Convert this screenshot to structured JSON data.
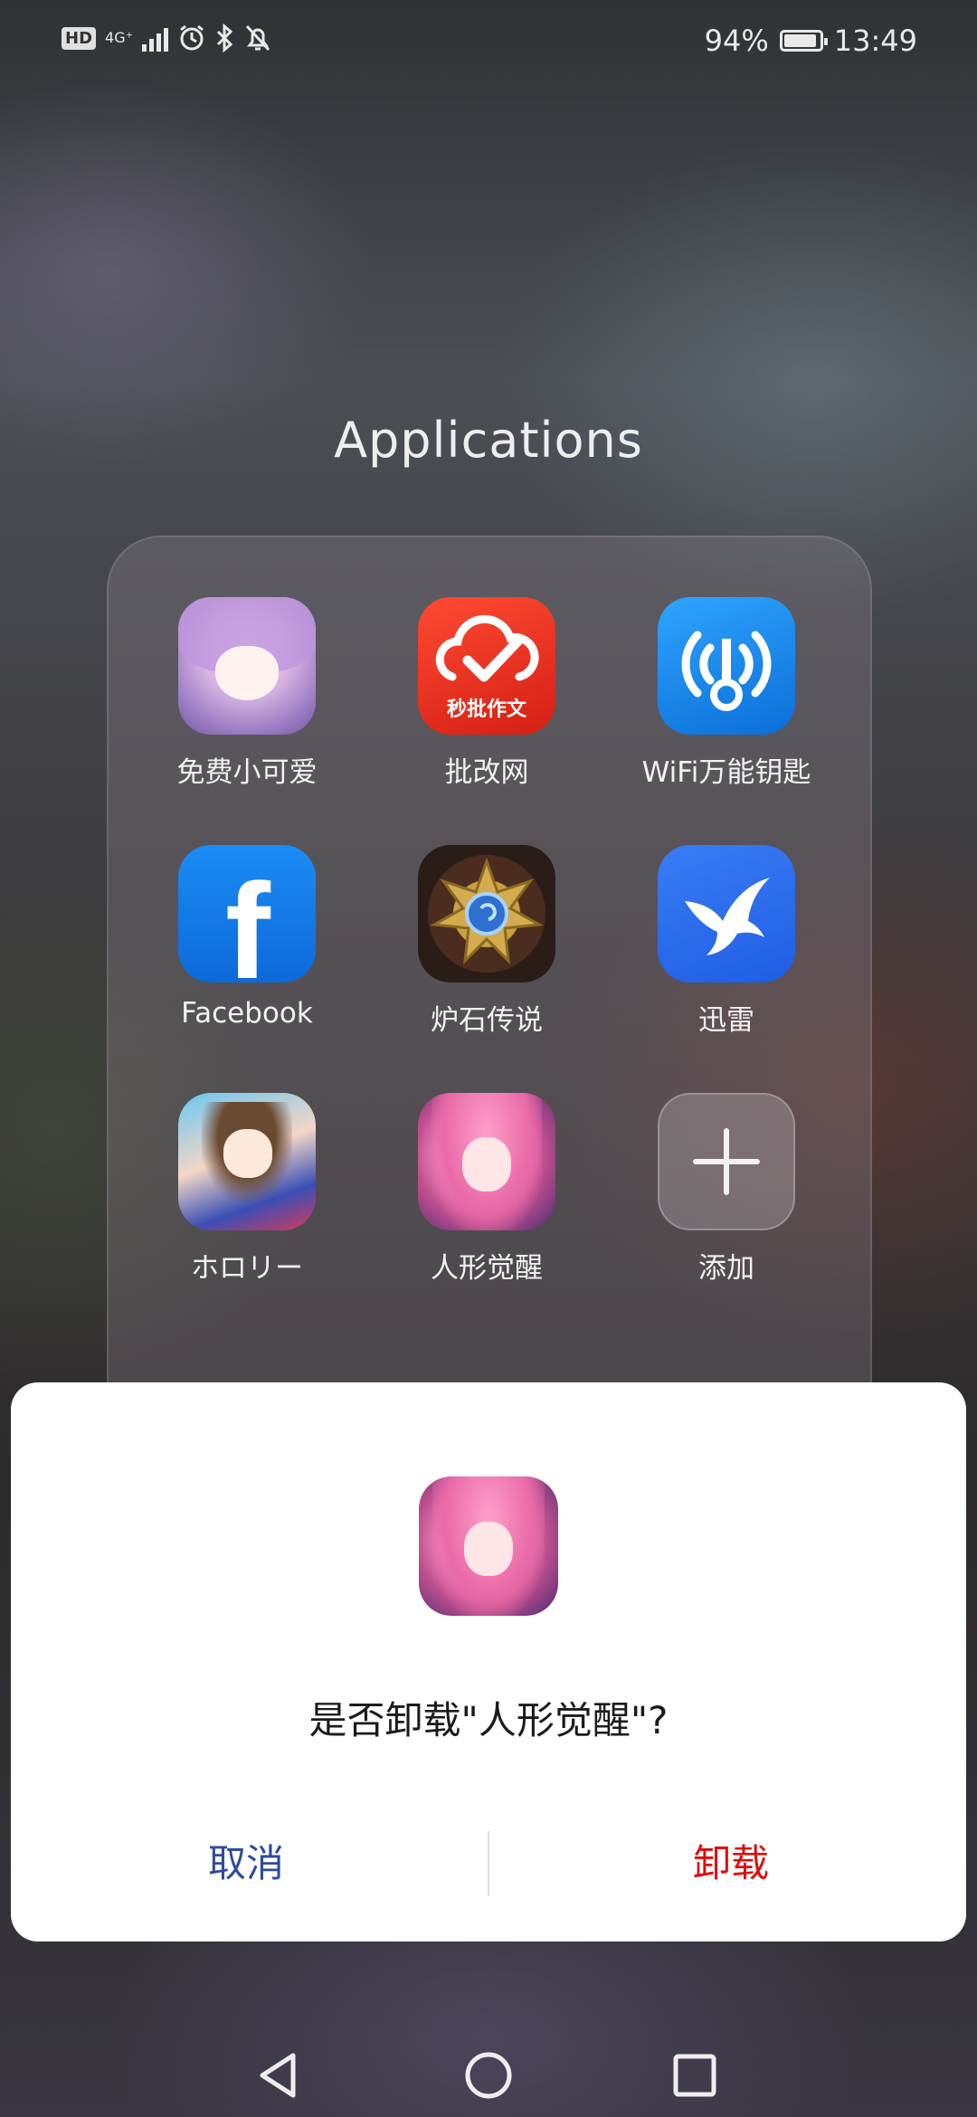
{
  "status_bar": {
    "hd": "HD",
    "network": "4G⁺",
    "battery_percent": "94%",
    "battery_level": 0.94,
    "time": "13:49"
  },
  "folder": {
    "title": "Applications",
    "apps": [
      {
        "label": "免费小可爱",
        "icon": "anime-girl-icon"
      },
      {
        "label": "批改网",
        "icon": "pigai-cloud-check-icon",
        "icon_text": "秒批作文"
      },
      {
        "label": "WiFi万能钥匙",
        "icon": "wifi-key-icon"
      },
      {
        "label": "Facebook",
        "icon": "facebook-icon",
        "icon_text": "f"
      },
      {
        "label": "炉石传说",
        "icon": "hearthstone-icon"
      },
      {
        "label": "迅雷",
        "icon": "xunlei-bird-icon"
      },
      {
        "label": "ホロリー",
        "icon": "hololive-girl-icon"
      },
      {
        "label": "人形觉醒",
        "icon": "renxing-girl-icon"
      },
      {
        "label": "添加",
        "icon": "plus-icon"
      }
    ]
  },
  "dialog": {
    "message": "是否卸载\"人形觉醒\"?",
    "cancel_label": "取消",
    "uninstall_label": "卸载"
  },
  "colors": {
    "cancel": "#2e4aa0",
    "uninstall": "#e00d0d"
  },
  "nav": {
    "back": "back-triangle-icon",
    "home": "home-circle-icon",
    "recents": "recents-square-icon"
  }
}
